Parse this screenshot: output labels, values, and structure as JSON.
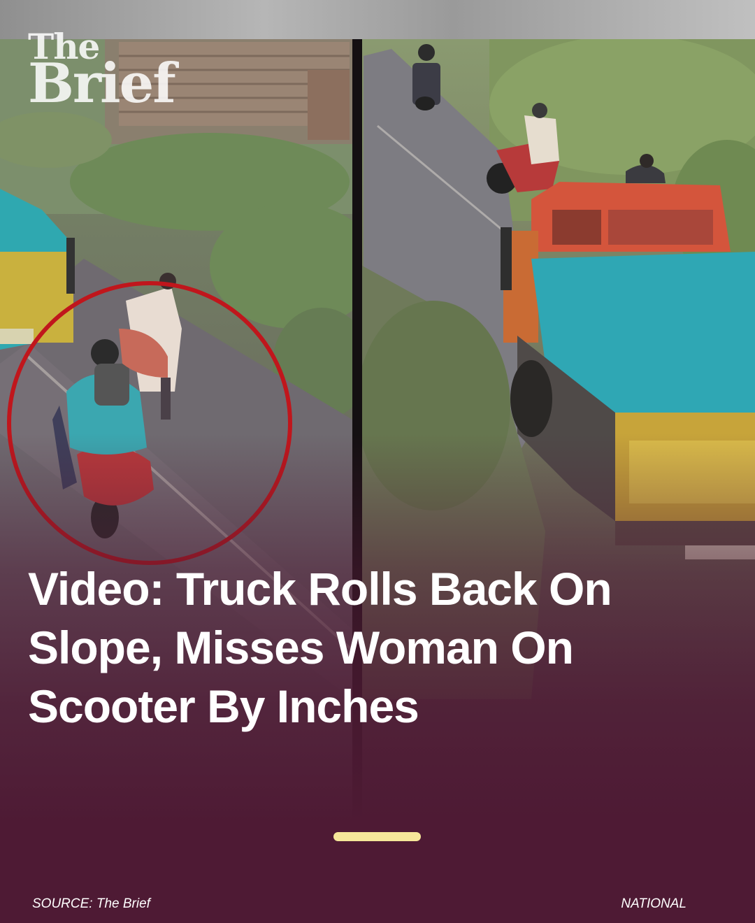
{
  "brand": {
    "logo_line1": "The",
    "logo_line2": "Brief"
  },
  "story": {
    "headline": "Video: Truck Rolls Back On Slope, Misses Woman On Scooter By Inches",
    "source": "SOURCE: The Brief",
    "category": "NATIONAL",
    "progress_percent": 100
  },
  "photo": {
    "highlight_color": "#c0161c",
    "panels": [
      "left-cctv-frame",
      "right-cctv-frame"
    ]
  },
  "colors": {
    "background": "#4e1a34",
    "progress": "#f6e79a",
    "text": "#ffffff"
  }
}
